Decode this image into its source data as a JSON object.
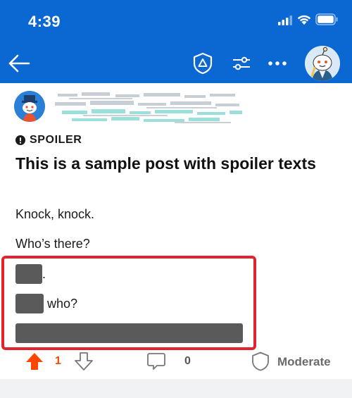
{
  "status_bar": {
    "time": "4:39",
    "background_color": "#0b68d3"
  },
  "nav": {
    "icons": [
      "back-arrow-icon",
      "mod-shield-icon",
      "filter-sliders-icon",
      "more-dots-icon",
      "user-avatar"
    ]
  },
  "post": {
    "spoiler_label": "SPOILER",
    "title": "This is a sample post with spoiler texts",
    "body": {
      "line1": "Knock, knock.",
      "line2": "Who’s there?",
      "row1_suffix": ".",
      "row2_suffix": " who?"
    }
  },
  "actions": {
    "vote_count": "1",
    "comment_count": "0",
    "moderate_label": "Moderate",
    "upvote_color": "#ff4500"
  },
  "highlight_color": "#e0232f",
  "spoiler_color": "#5a5a5a"
}
